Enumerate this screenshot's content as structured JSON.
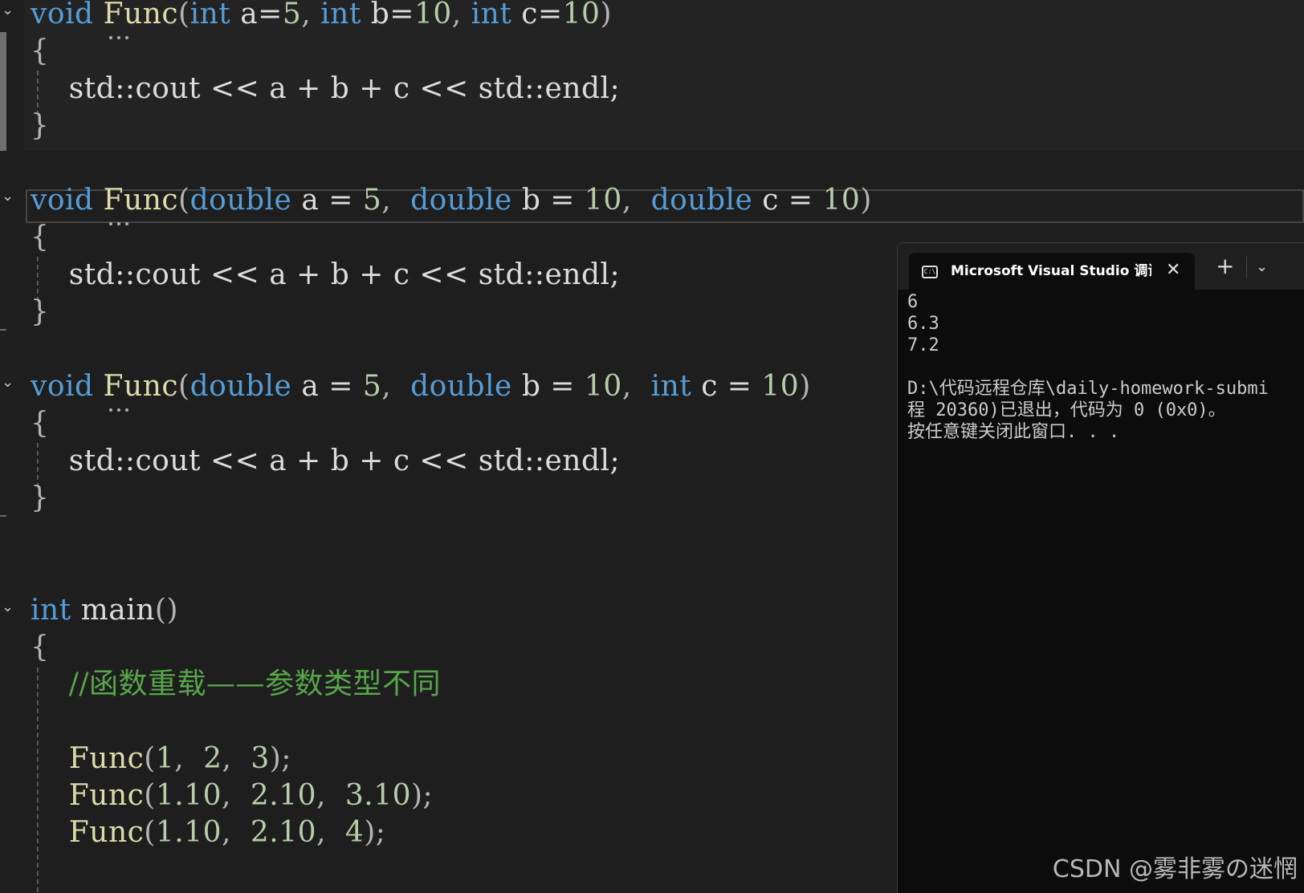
{
  "editor": {
    "lines": [
      {
        "id": "func1-sig",
        "tokens": [
          {
            "t": "void",
            "c": "kw"
          },
          {
            "t": " "
          },
          {
            "t": "Func",
            "c": "fn"
          },
          {
            "t": "(",
            "c": "punc"
          },
          {
            "t": "int",
            "c": "kw"
          },
          {
            "t": " a="
          },
          {
            "t": "5",
            "c": "num"
          },
          {
            "t": ", ",
            "c": "punc"
          },
          {
            "t": "int",
            "c": "kw"
          },
          {
            "t": " b="
          },
          {
            "t": "10",
            "c": "num"
          },
          {
            "t": ", ",
            "c": "punc"
          },
          {
            "t": "int",
            "c": "kw"
          },
          {
            "t": " c="
          },
          {
            "t": "10",
            "c": "num"
          },
          {
            "t": ")",
            "c": "punc"
          }
        ]
      },
      {
        "id": "func1-open",
        "tokens": [
          {
            "t": "{",
            "c": "punc"
          }
        ]
      },
      {
        "id": "func1-body",
        "tokens": [
          {
            "t": "    std::cout << a + b + c << std::endl;"
          }
        ]
      },
      {
        "id": "func1-close",
        "tokens": [
          {
            "t": "}",
            "c": "punc"
          }
        ]
      },
      {
        "id": "func2-sig",
        "tokens": [
          {
            "t": "void",
            "c": "kw"
          },
          {
            "t": " "
          },
          {
            "t": "Func",
            "c": "fn"
          },
          {
            "t": "(",
            "c": "punc"
          },
          {
            "t": "double",
            "c": "kw"
          },
          {
            "t": " a = "
          },
          {
            "t": "5",
            "c": "num"
          },
          {
            "t": ",  ",
            "c": "punc"
          },
          {
            "t": "double",
            "c": "kw"
          },
          {
            "t": " b = "
          },
          {
            "t": "10",
            "c": "num"
          },
          {
            "t": ",  ",
            "c": "punc"
          },
          {
            "t": "double",
            "c": "kw"
          },
          {
            "t": " c = "
          },
          {
            "t": "10",
            "c": "num"
          },
          {
            "t": ")",
            "c": "punc"
          }
        ]
      },
      {
        "id": "func2-open",
        "tokens": [
          {
            "t": "{",
            "c": "punc"
          }
        ]
      },
      {
        "id": "func2-body",
        "tokens": [
          {
            "t": "    std::cout << a + b + c << std::endl;"
          }
        ]
      },
      {
        "id": "func2-close",
        "tokens": [
          {
            "t": "}",
            "c": "punc"
          }
        ]
      },
      {
        "id": "func3-sig",
        "tokens": [
          {
            "t": "void",
            "c": "kw"
          },
          {
            "t": " "
          },
          {
            "t": "Func",
            "c": "fn"
          },
          {
            "t": "(",
            "c": "punc"
          },
          {
            "t": "double",
            "c": "kw"
          },
          {
            "t": " a = "
          },
          {
            "t": "5",
            "c": "num"
          },
          {
            "t": ",  ",
            "c": "punc"
          },
          {
            "t": "double",
            "c": "kw"
          },
          {
            "t": " b = "
          },
          {
            "t": "10",
            "c": "num"
          },
          {
            "t": ",  ",
            "c": "punc"
          },
          {
            "t": "int",
            "c": "kw"
          },
          {
            "t": " c = "
          },
          {
            "t": "10",
            "c": "num"
          },
          {
            "t": ")",
            "c": "punc"
          }
        ]
      },
      {
        "id": "func3-open",
        "tokens": [
          {
            "t": "{",
            "c": "punc"
          }
        ]
      },
      {
        "id": "func3-body",
        "tokens": [
          {
            "t": "    std::cout << a + b + c << std::endl;"
          }
        ]
      },
      {
        "id": "func3-close",
        "tokens": [
          {
            "t": "}",
            "c": "punc"
          }
        ]
      },
      {
        "id": "main-sig",
        "tokens": [
          {
            "t": "int",
            "c": "kw"
          },
          {
            "t": " main"
          },
          {
            "t": "()",
            "c": "punc"
          }
        ]
      },
      {
        "id": "main-open",
        "tokens": [
          {
            "t": "{",
            "c": "punc"
          }
        ]
      },
      {
        "id": "main-comment",
        "tokens": [
          {
            "t": "    "
          },
          {
            "t": "//函数重载——参数类型不同",
            "c": "cm"
          }
        ]
      },
      {
        "id": "main-call1",
        "tokens": [
          {
            "t": "    "
          },
          {
            "t": "Func",
            "c": "fn"
          },
          {
            "t": "(",
            "c": "punc"
          },
          {
            "t": "1",
            "c": "num"
          },
          {
            "t": ",  ",
            "c": "punc"
          },
          {
            "t": "2",
            "c": "num"
          },
          {
            "t": ",  ",
            "c": "punc"
          },
          {
            "t": "3",
            "c": "num"
          },
          {
            "t": ");",
            "c": "punc"
          }
        ]
      },
      {
        "id": "main-call2",
        "tokens": [
          {
            "t": "    "
          },
          {
            "t": "Func",
            "c": "fn"
          },
          {
            "t": "(",
            "c": "punc"
          },
          {
            "t": "1.10",
            "c": "num"
          },
          {
            "t": ",  ",
            "c": "punc"
          },
          {
            "t": "2.10",
            "c": "num"
          },
          {
            "t": ",  ",
            "c": "punc"
          },
          {
            "t": "3.10",
            "c": "num"
          },
          {
            "t": ");",
            "c": "punc"
          }
        ]
      },
      {
        "id": "main-call3",
        "tokens": [
          {
            "t": "    "
          },
          {
            "t": "Func",
            "c": "fn"
          },
          {
            "t": "(",
            "c": "punc"
          },
          {
            "t": "1.10",
            "c": "num"
          },
          {
            "t": ",  ",
            "c": "punc"
          },
          {
            "t": "2.10",
            "c": "num"
          },
          {
            "t": ",  ",
            "c": "punc"
          },
          {
            "t": "4",
            "c": "num"
          },
          {
            "t": ");",
            "c": "punc"
          }
        ]
      }
    ],
    "colors": {
      "keyword": "#569cd6",
      "function": "#dcdcaa",
      "number": "#b5cea8",
      "comment": "#57a64a",
      "text": "#dcdcdc",
      "background": "#1e1e1e"
    }
  },
  "console": {
    "tab_icon": "terminal-icon",
    "tab_icon_text": "C:\\",
    "tab_title": "Microsoft Visual Studio 调试控制台",
    "close_glyph": "✕",
    "new_tab_glyph": "+",
    "dropdown_glyph": "⌄",
    "output": [
      "6",
      "6.3",
      "7.2",
      "",
      "D:\\代码远程仓库\\daily-homework-submi",
      "程 20360)已退出，代码为 0 (0x0)。",
      "按任意键关闭此窗口. . ."
    ],
    "background": "#0c0c0c"
  },
  "watermark": "CSDN @雾非雾の迷惘"
}
